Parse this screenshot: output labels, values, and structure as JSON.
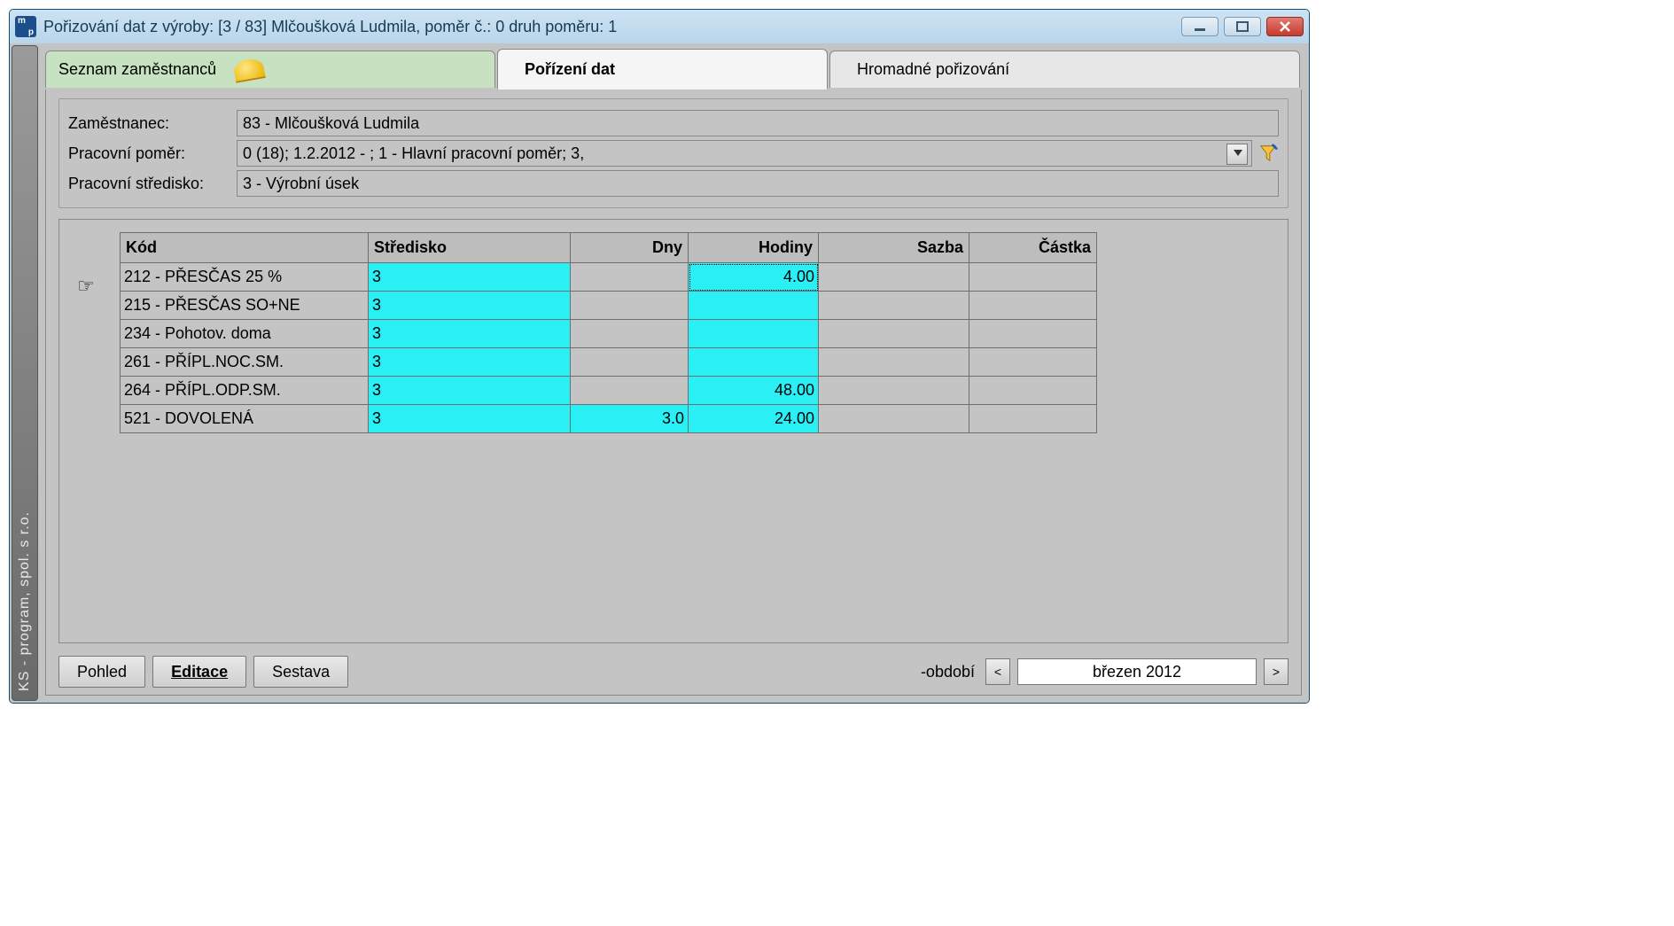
{
  "window_title": "Pořizování dat z výroby: [3 / 83] Mlčoušková Ludmila,  poměr č.: 0 druh poměru: 1",
  "vstrip_text": "KS - program, spol. s r.o.",
  "tabs": {
    "t1": "Seznam zaměstnanců",
    "t2": "Pořízení dat",
    "t3": "Hromadné pořizování"
  },
  "info": {
    "label_employee": "Zaměstnanec:",
    "employee_value": "83 - Mlčoušková Ludmila",
    "label_ratio": "Pracovní poměr:",
    "ratio_value": "0   (18); 1.2.2012 - ; 1 - Hlavní pracovní poměr; 3,",
    "label_center": "Pracovní středisko:",
    "center_value": "3 - Výrobní úsek"
  },
  "grid": {
    "headers": {
      "kod": "Kód",
      "str": "Středisko",
      "dny": "Dny",
      "hod": "Hodiny",
      "sazba": "Sazba",
      "castka": "Částka"
    },
    "rows": [
      {
        "kod": "212 - PŘESČAS 25 %",
        "str": "3",
        "dny": "",
        "hod": "4.00",
        "sazba": "",
        "castka": "",
        "hod_focus": true
      },
      {
        "kod": "215 - PŘESČAS SO+NE",
        "str": "3",
        "dny": "",
        "hod": "",
        "sazba": "",
        "castka": ""
      },
      {
        "kod": "234 - Pohotov. doma",
        "str": "3",
        "dny": "",
        "hod": "",
        "sazba": "",
        "castka": ""
      },
      {
        "kod": "261 - PŘÍPL.NOC.SM.",
        "str": "3",
        "dny": "",
        "hod": "",
        "sazba": "",
        "castka": ""
      },
      {
        "kod": "264 - PŘÍPL.ODP.SM.",
        "str": "3",
        "dny": "",
        "hod": "48.00",
        "sazba": "",
        "castka": ""
      },
      {
        "kod": "521 - DOVOLENÁ",
        "str": "3",
        "dny": "3.0",
        "hod": "24.00",
        "sazba": "",
        "castka": ""
      }
    ]
  },
  "bottom": {
    "btn_view": "Pohled",
    "btn_edit": "Editace",
    "btn_report": "Sestava",
    "period_label": "-období",
    "period_value": "březen 2012",
    "prev": "<",
    "next": ">"
  }
}
